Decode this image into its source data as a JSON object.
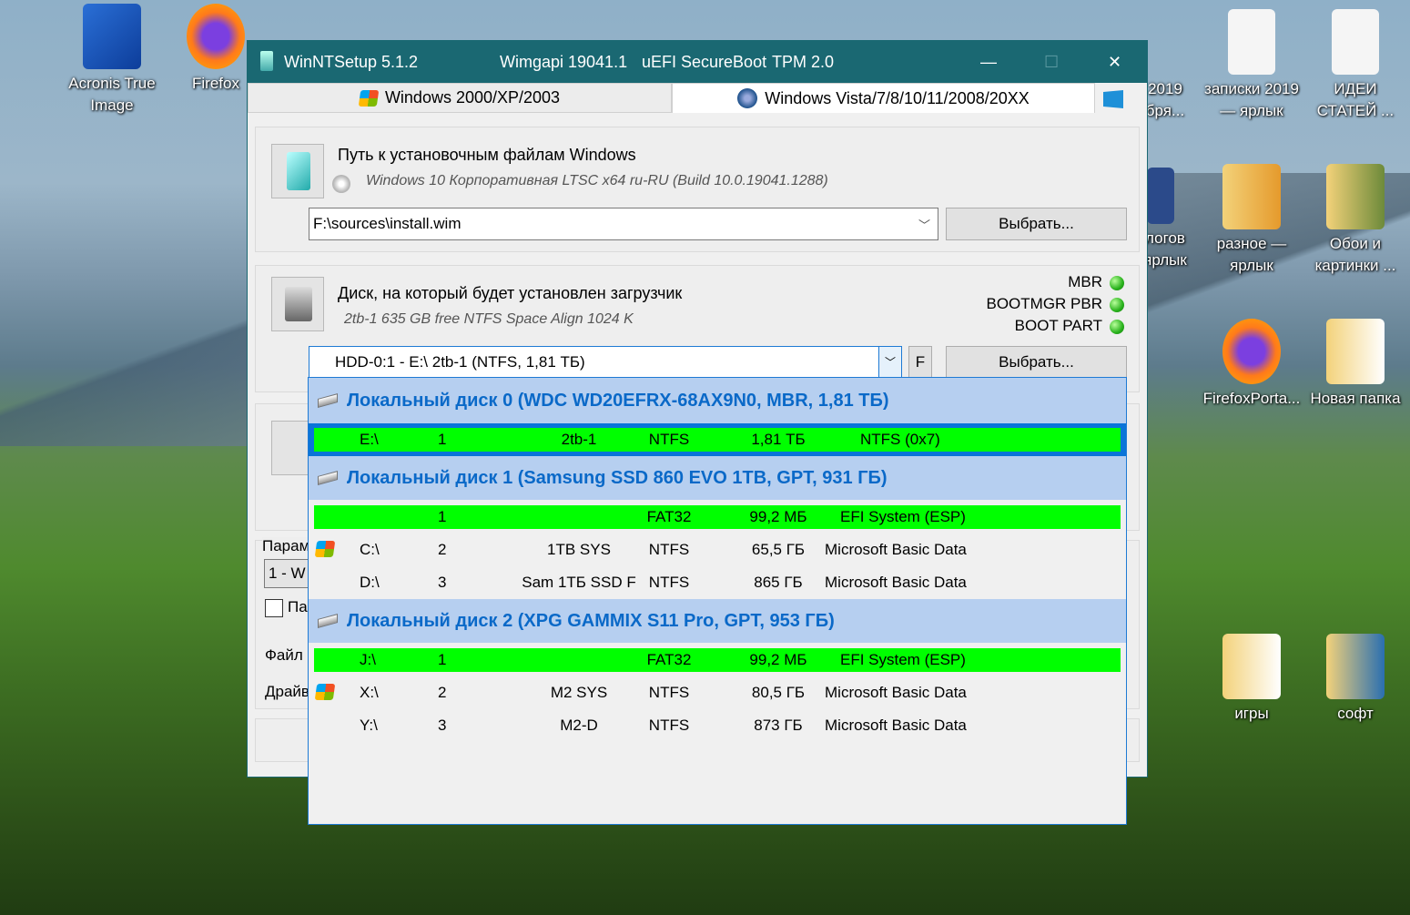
{
  "desktop": {
    "icons_left": [
      {
        "label": "Acronis True Image"
      },
      {
        "label": "Firefox"
      }
    ],
    "icons_right": [
      {
        "label": "2019 бря..."
      },
      {
        "label": "записки 2019 — ярлык"
      },
      {
        "label": "ИДЕИ СТАТЕЙ ..."
      },
      {
        "label": "логов ярлык"
      },
      {
        "label": "разное — ярлык"
      },
      {
        "label": "Обои и картинки ..."
      },
      {
        "label": "FirefoxPorta..."
      },
      {
        "label": "Новая папка"
      },
      {
        "label": "игры"
      },
      {
        "label": "софт"
      }
    ]
  },
  "window": {
    "title": "WinNTSetup 5.1.2",
    "wimgapi": "Wimgapi 19041.1",
    "secureboot": "uEFI SecureBoot",
    "tpm": "TPM 2.0",
    "minimize": "—",
    "maximize": "☐",
    "close": "✕"
  },
  "tabs": [
    {
      "label": "Windows 2000/XP/2003"
    },
    {
      "label": "Windows Vista/7/8/10/11/2008/20XX"
    }
  ],
  "source": {
    "label": "Путь к установочным файлам Windows",
    "info": "Windows 10 Корпоративная LTSC  x64 ru-RU (Build 10.0.19041.1288)",
    "path": "F:\\sources\\install.wim",
    "select": "Выбрать..."
  },
  "boot": {
    "label": "Диск, на который будет установлен загрузчик",
    "info": "2tb-1 635 GB free NTFS Space Align 1024 K",
    "status": [
      {
        "label": "MBR",
        "color": "#29b21c"
      },
      {
        "label": "BOOTMGR PBR",
        "color": "#29b21c"
      },
      {
        "label": "BOOT PART",
        "color": "#29b21c"
      }
    ],
    "value": "HDD-0:1 - E:\\ 2tb-1 (NTFS, 1,81 ТБ)",
    "f_button": "F",
    "select": "Выбрать..."
  },
  "behind": {
    "params": "Парам",
    "edition": "1 - W",
    "checkbox": "Па",
    "file": "Файл",
    "drivers": "Драйв"
  },
  "disks": [
    {
      "header": "Локальный диск 0 (WDC WD20EFRX-68AX9N0, MBR, 1,81 ТБ)",
      "partitions": [
        {
          "letter": "E:\\",
          "num": "1",
          "label": "2tb-1",
          "fs": "NTFS",
          "size": "1,81 ТБ",
          "type": "NTFS (0x7)",
          "green": true,
          "selected": true,
          "win": false
        }
      ]
    },
    {
      "header": "Локальный диск 1 (Samsung SSD 860 EVO 1TB, GPT, 931 ГБ)",
      "partitions": [
        {
          "letter": "",
          "num": "1",
          "label": "",
          "fs": "FAT32",
          "size": "99,2 МБ",
          "type": "EFI System (ESP)",
          "green": true,
          "win": false
        },
        {
          "letter": "C:\\",
          "num": "2",
          "label": "1TB SYS",
          "fs": "NTFS",
          "size": "65,5 ГБ",
          "type": "Microsoft Basic Data",
          "win": true
        },
        {
          "letter": "D:\\",
          "num": "3",
          "label": "Sam 1ТБ SSD F",
          "fs": "NTFS",
          "size": "865 ГБ",
          "type": "Microsoft Basic Data",
          "win": false
        }
      ]
    },
    {
      "header": "Локальный диск 2 (XPG GAMMIX S11 Pro, GPT, 953 ГБ)",
      "partitions": [
        {
          "letter": "J:\\",
          "num": "1",
          "label": "",
          "fs": "FAT32",
          "size": "99,2 МБ",
          "type": "EFI System (ESP)",
          "green": true,
          "win": false
        },
        {
          "letter": "X:\\",
          "num": "2",
          "label": "M2 SYS",
          "fs": "NTFS",
          "size": "80,5 ГБ",
          "type": "Microsoft Basic Data",
          "win": true
        },
        {
          "letter": "Y:\\",
          "num": "3",
          "label": "M2-D",
          "fs": "NTFS",
          "size": "873 ГБ",
          "type": "Microsoft Basic Data",
          "win": false
        }
      ]
    }
  ]
}
